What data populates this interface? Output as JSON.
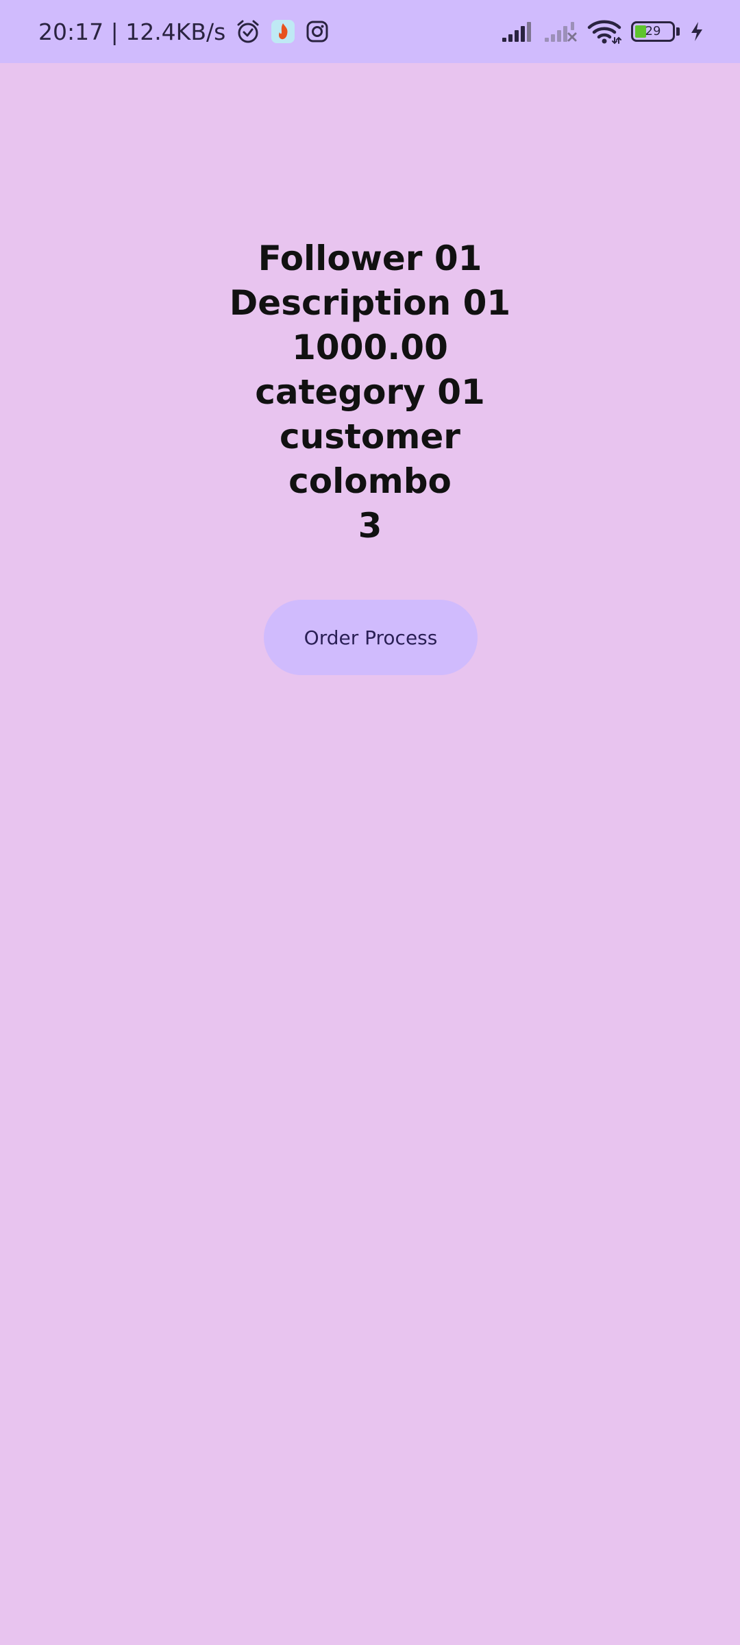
{
  "status_bar": {
    "time_speed": "20:17 | 12.4KB/s",
    "battery_level": "29",
    "icons": [
      "alarm-icon",
      "app-notification-icon",
      "instagram-icon",
      "signal-icon",
      "signal-no-service-icon",
      "wifi-icon",
      "battery-icon",
      "charging-icon"
    ],
    "colors": {
      "background": "#d0bbfd",
      "battery_fill": "#5fc42e",
      "app_icon": "#e8521e"
    }
  },
  "details": {
    "follower": "Follower 01",
    "description": "Description 01",
    "price": "1000.00",
    "category": "category 01",
    "customer": "customer",
    "location": "colombo",
    "quantity": "3"
  },
  "actions": {
    "order_button_label": "Order Process"
  },
  "colors": {
    "page_background": "#e8c4ef",
    "button_background": "#d0bbfd"
  }
}
